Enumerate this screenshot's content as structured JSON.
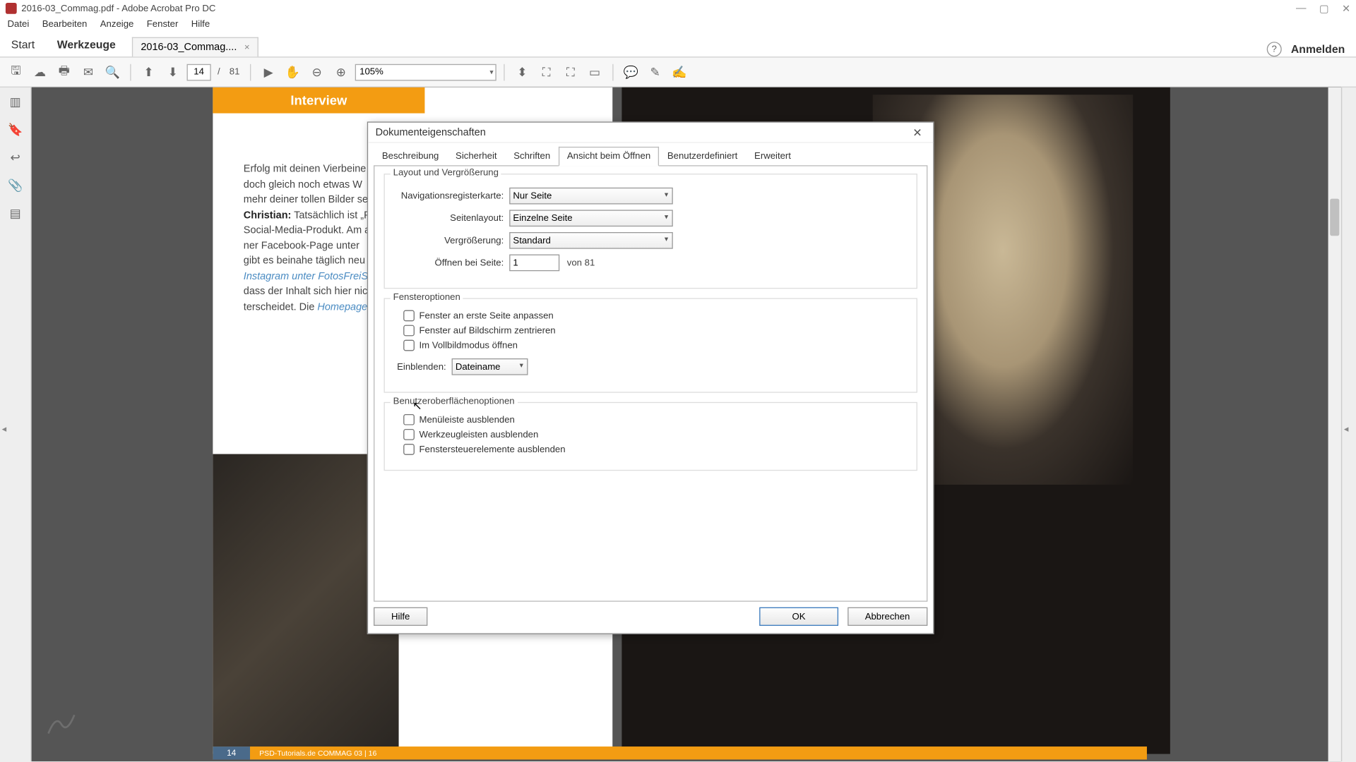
{
  "app": {
    "title": "2016-03_Commag.pdf - Adobe Acrobat Pro DC"
  },
  "win_buttons": {
    "min": "—",
    "max": "▢",
    "close": "✕"
  },
  "menu": [
    "Datei",
    "Bearbeiten",
    "Anzeige",
    "Fenster",
    "Hilfe"
  ],
  "main_tabs": {
    "start": "Start",
    "tools": "Werkzeuge"
  },
  "doc_tab": {
    "label": "2016-03_Commag....",
    "close": "×"
  },
  "login": "Anmelden",
  "toolbar": {
    "page_current": "14",
    "page_sep": "/",
    "page_total": "81",
    "zoom": "105%"
  },
  "article": {
    "line1": "Erfolg mit deinen Vierbeine",
    "line2": "doch gleich noch etwas W",
    "line3": "mehr deiner tollen Bilder se",
    "line4a": "Christian:",
    "line4b": " Tatsächlich ist „Fo",
    "line5": "Social-Media-Produkt. Am al",
    "line6": "ner Facebook-Page unter",
    "line7": "gibt es beinahe täglich neu",
    "line8a": "Instagram unter FotosFreiS",
    "line9": "dass der Inhalt sich hier nich",
    "line10a": "terscheidet. Die ",
    "line10b": "Homepage"
  },
  "interview": "Interview",
  "footer": {
    "page": "14",
    "text": "PSD-Tutorials.de  COMMAG 03 | 16"
  },
  "dialog": {
    "title": "Dokumenteigenschaften",
    "tabs": [
      "Beschreibung",
      "Sicherheit",
      "Schriften",
      "Ansicht beim Öffnen",
      "Benutzerdefiniert",
      "Erweitert"
    ],
    "active_tab": 3,
    "section1": {
      "title": "Layout und Vergrößerung",
      "nav_label": "Navigationsregisterkarte:",
      "nav_value": "Nur Seite",
      "layout_label": "Seitenlayout:",
      "layout_value": "Einzelne Seite",
      "mag_label": "Vergrößerung:",
      "mag_value": "Standard",
      "open_label": "Öffnen bei Seite:",
      "open_value": "1",
      "open_suffix": "von 81"
    },
    "section2": {
      "title": "Fensteroptionen",
      "chk1": "Fenster an erste Seite anpassen",
      "chk2": "Fenster auf Bildschirm zentrieren",
      "chk3": "Im Vollbildmodus öffnen",
      "show_label": "Einblenden:",
      "show_value": "Dateiname"
    },
    "section3": {
      "title": "Benutzeroberflächenoptionen",
      "chk1": "Menüleiste ausblenden",
      "chk2": "Werkzeugleisten ausblenden",
      "chk3": "Fenstersteuerelemente ausblenden"
    },
    "buttons": {
      "help": "Hilfe",
      "ok": "OK",
      "cancel": "Abbrechen"
    }
  }
}
